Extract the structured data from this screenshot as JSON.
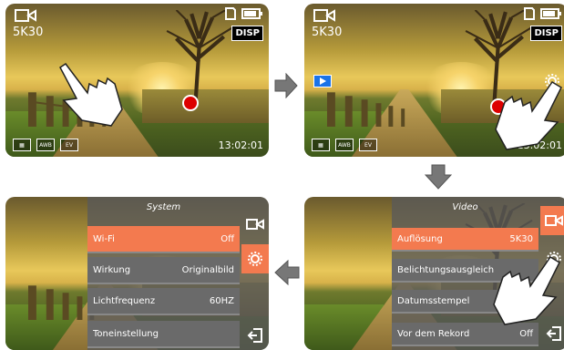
{
  "colors": {
    "accent": "#f37a4f",
    "record": "#d00000"
  },
  "panel1": {
    "resolution": "5K30",
    "disp": "DISP",
    "time": "13:02:01",
    "awb": "AWB",
    "ev": "EV"
  },
  "panel2": {
    "resolution": "5K30",
    "disp": "DISP",
    "time": "13:02:01",
    "awb": "AWB",
    "ev": "EV"
  },
  "panel3": {
    "title": "Video",
    "rows": [
      {
        "label": "Auflösung",
        "value": "5K30"
      },
      {
        "label": "Belichtungsausgleich",
        "value": ""
      },
      {
        "label": "Datumsstempel",
        "value": ""
      },
      {
        "label": "Vor dem Rekord",
        "value": "Off"
      }
    ]
  },
  "panel4": {
    "title": "System",
    "rows": [
      {
        "label": "Wi-Fi",
        "value": "Off"
      },
      {
        "label": "Wirkung",
        "value": "Originalbild"
      },
      {
        "label": "Lichtfrequenz",
        "value": "60HZ"
      },
      {
        "label": "Toneinstellung",
        "value": ""
      }
    ]
  },
  "icons": [
    "video-camera-icon",
    "gear-icon",
    "exit-icon",
    "battery-icon",
    "sd-card-icon",
    "play-icon",
    "hand-pointer-icon",
    "arrow-right-icon",
    "arrow-down-icon",
    "arrow-left-icon"
  ]
}
